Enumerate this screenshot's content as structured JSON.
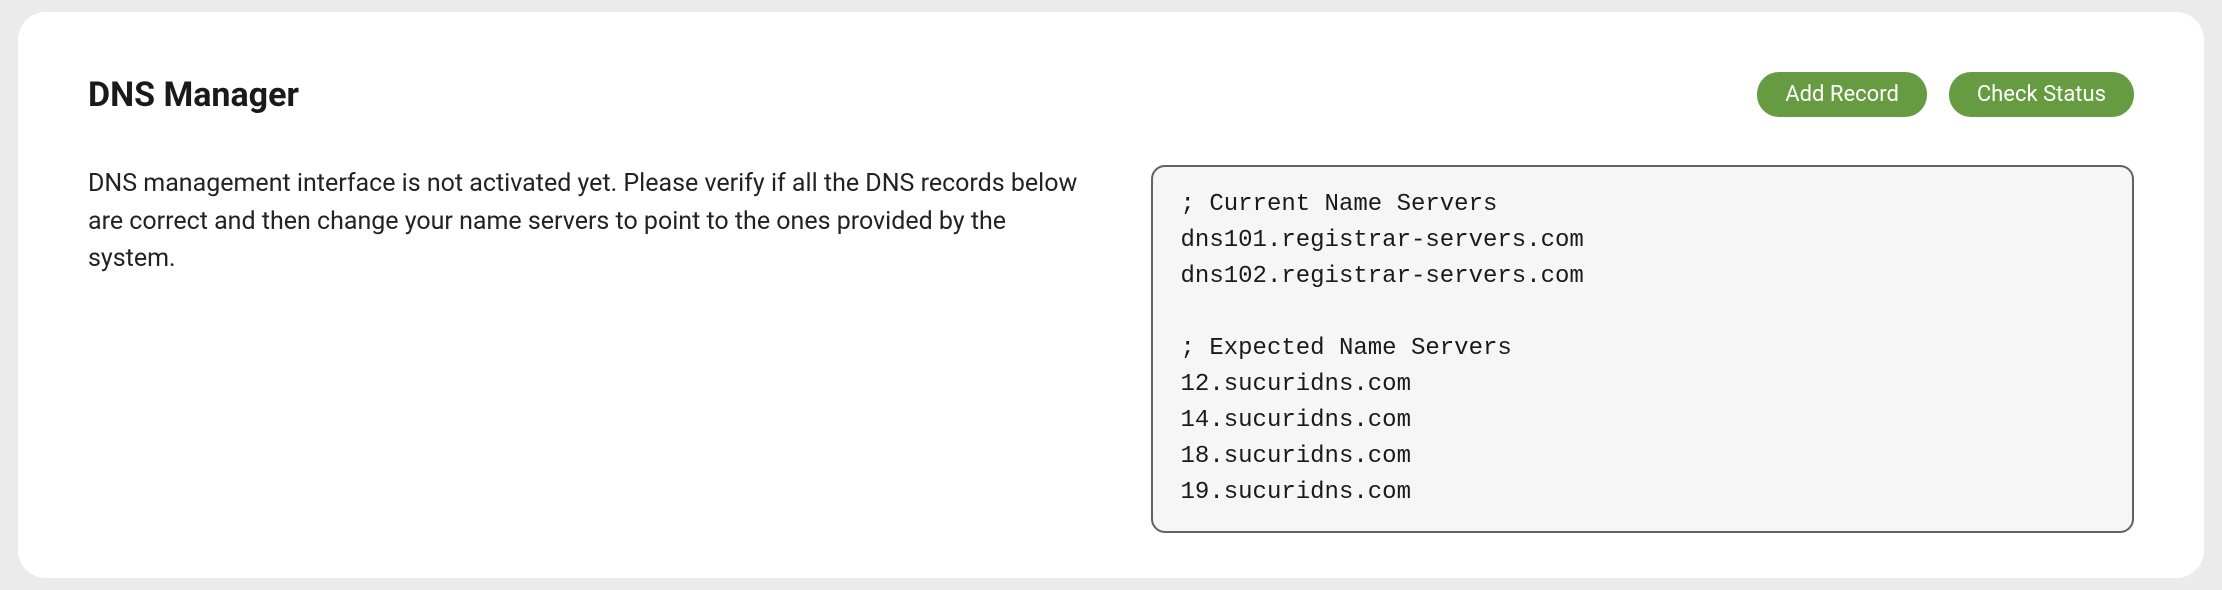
{
  "header": {
    "title": "DNS Manager",
    "buttons": {
      "add_record": "Add Record",
      "check_status": "Check Status"
    }
  },
  "main": {
    "description": "DNS management interface is not activated yet. Please verify if all the DNS records below are correct and then change your name servers to point to the ones provided by the system.",
    "code_block": "; Current Name Servers\ndns101.registrar-servers.com\ndns102.registrar-servers.com\n\n; Expected Name Servers\n12.sucuridns.com\n14.sucuridns.com\n18.sucuridns.com\n19.sucuridns.com"
  },
  "colors": {
    "button_bg": "#679b41",
    "panel_bg": "#ffffff",
    "page_bg": "#ebebeb",
    "code_bg": "#f6f6f6",
    "code_border": "#626262"
  }
}
